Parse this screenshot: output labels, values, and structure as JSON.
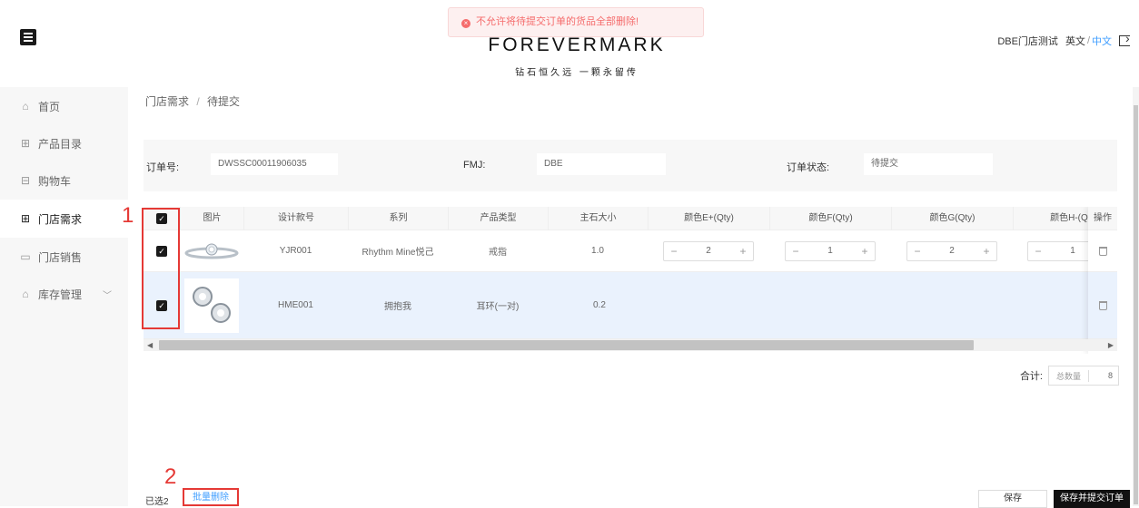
{
  "alert": {
    "text": "不允许将待提交订单的货品全部删除!",
    "icon": "x-circle-icon",
    "color": "#f56c6c"
  },
  "brand": {
    "logo": "FOREVERMARK",
    "tagline": "钻石恒久远 一颗永留传"
  },
  "user": {
    "name": "DBE门店测试",
    "lang_en": "英文",
    "lang_sep": "/",
    "lang_zh": "中文"
  },
  "sidebar": {
    "items": [
      {
        "label": "首页",
        "icon": "home-icon"
      },
      {
        "label": "产品目录",
        "icon": "grid-icon"
      },
      {
        "label": "购物车",
        "icon": "cart-icon"
      },
      {
        "label": "门店需求",
        "icon": "grid-icon",
        "active": true
      },
      {
        "label": "门店销售",
        "icon": "monitor-icon"
      },
      {
        "label": "库存管理",
        "icon": "store-icon",
        "expandable": true
      }
    ]
  },
  "breadcrumb": {
    "parent": "门店需求",
    "sep": "/",
    "current": "待提交"
  },
  "order": {
    "number_label": "订单号:",
    "number_value": "DWSSC00011906035",
    "fmj_label": "FMJ:",
    "fmj_value": "DBE",
    "status_label": "订单状态:",
    "status_value": "待提交"
  },
  "table": {
    "headers": [
      "图片",
      "设计款号",
      "系列",
      "产品类型",
      "主石大小",
      "颜色E+(Qty)",
      "颜色F(Qty)",
      "颜色G(Qty)",
      "颜色H-(Qty)",
      "操作"
    ],
    "rows": [
      {
        "design": "YJR001",
        "series": "Rhythm Mine悦己",
        "type": "戒指",
        "size": "1.0",
        "qty": [
          "2",
          "1",
          "2",
          "1"
        ],
        "checked": true
      },
      {
        "design": "HME001",
        "series": "拥抱我",
        "type": "耳环(一对)",
        "size": "0.2",
        "qty": [],
        "checked": true
      }
    ]
  },
  "stepper": {
    "minus": "−",
    "plus": "+"
  },
  "total": {
    "label": "合计:",
    "field": "总数量",
    "value": "8"
  },
  "footer": {
    "selected": "已选2",
    "batch_delete": "批量删除",
    "save": "保存",
    "save_submit": "保存并提交订单"
  },
  "annotations": {
    "one": "1",
    "two": "2",
    "color": "#e53935"
  },
  "colors": {
    "accent": "#409eff",
    "selected_row": "#eaf2fd",
    "dark": "#111111"
  }
}
